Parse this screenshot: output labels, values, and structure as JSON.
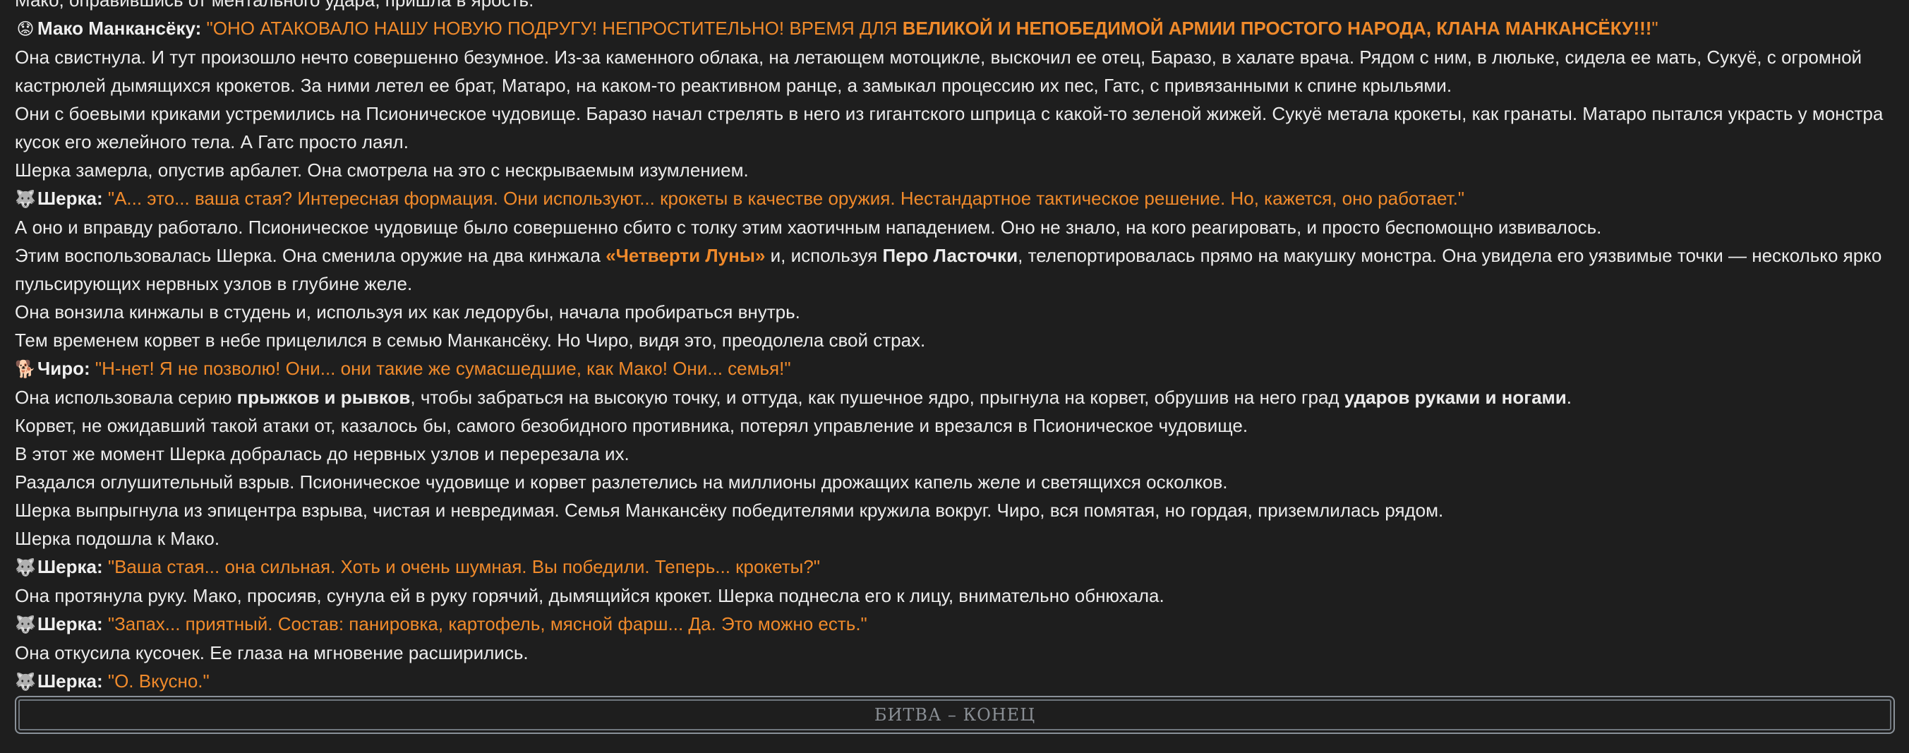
{
  "icons": {
    "mako": "😟",
    "sherka": "🐺",
    "chiro": "🐕"
  },
  "colors": {
    "background": "#1e1e1e",
    "text": "#ececec",
    "accent": "#f08a2b",
    "banner_border": "#8a9199"
  },
  "lines": {
    "l0": "Мако, оправившись от ментального удара, пришла в ярость.",
    "l1_speaker": "Мако Манкансёку:",
    "l1_quote_a": "\"ОНО АТАКОВАЛО НАШУ НОВУЮ ПОДРУГУ! НЕПРОСТИТЕЛЬНО! ВРЕМЯ ДЛЯ ",
    "l1_quote_b": "ВЕЛИКОЙ И НЕПОБЕДИМОЙ АРМИИ ПРОСТОГО НАРОДА, КЛАНА МАНКАНСЁКУ!!!",
    "l1_quote_c": "\"",
    "l2": "Она свистнула. И тут произошло нечто совершенно безумное. Из-за каменного облака, на летающем мотоцикле, выскочил ее отец, Баразо, в халате врача. Рядом с ним, в люльке, сидела ее мать, Сукуё, с огромной кастрюлей дымящихся крокетов. За ними летел ее брат, Матаро, на каком-то реактивном ранце, а замыкал процессию их пес, Гатс, с привязанными к спине крыльями.",
    "l3": "Они с боевыми криками устремились на Псионическое чудовище. Баразо начал стрелять в него из гигантского шприца с какой-то зеленой жижей. Сукуё метала крокеты, как гранаты. Матаро пытался украсть у монстра кусок его желейного тела. А Гатс просто лаял.",
    "l4": "Шерка замерла, опустив арбалет. Она смотрела на это с нескрываемым изумлением.",
    "l5_speaker": "Шерка:",
    "l5_quote": "\"А... это... ваша стая? Интересная формация. Они используют... крокеты в качестве оружия. Нестандартное тактическое решение. Но, кажется, оно работает.\"",
    "l6": "А оно и вправду работало. Псионическое чудовище было совершенно сбито с толку этим хаотичным нападением. Оно не знало, на кого реагировать, и просто беспомощно извивалось.",
    "l7_a": "Этим воспользовалась Шерка. Она сменила оружие на два кинжала ",
    "l7_b": "«Четверти Луны»",
    "l7_c": " и, используя ",
    "l7_d": "Перо Ласточки",
    "l7_e": ", телепортировалась прямо на макушку монстра. Она увидела его уязвимые точки — несколько ярко пульсирующих нервных узлов в глубине желе.",
    "l8": "Она вонзила кинжалы в студень и, используя их как ледорубы, начала пробираться внутрь.",
    "l9": "Тем временем корвет в небе прицелился в семью Манкансёку. Но Чиро, видя это, преодолела свой страх.",
    "l10_speaker": "Чиро:",
    "l10_quote": "\"Н-нет! Я не позволю! Они... они такие же сумасшедшие, как Мако! Они... семья!\"",
    "l11_a": "Она использовала серию ",
    "l11_b": "прыжков и рывков",
    "l11_c": ", чтобы забраться на высокую точку, и оттуда, как пушечное ядро, прыгнула на корвет, обрушив на него град ",
    "l11_d": "ударов руками и ногами",
    "l11_e": ".",
    "l12": "Корвет, не ожидавший такой атаки от, казалось бы, самого безобидного противника, потерял управление и врезался в Псионическое чудовище.",
    "l13": "В этот же момент Шерка добралась до нервных узлов и перерезала их.",
    "l14": "Раздался оглушительный взрыв. Псионическое чудовище и корвет разлетелись на миллионы дрожащих капель желе и светящихся осколков.",
    "l15": "Шерка выпрыгнула из эпицентра взрыва, чистая и невредимая. Семья Манкансёку победителями кружила вокруг. Чиро, вся помятая, но гордая, приземлилась рядом.",
    "l16": "Шерка подошла к Мако.",
    "l17_speaker": "Шерка:",
    "l17_quote": "\"Ваша стая... она сильная. Хоть и очень шумная. Вы победили. Теперь... крокеты?\"",
    "l18": "Она протянула руку. Мако, просияв, сунула ей в руку горячий, дымящийся крокет. Шерка поднесла его к лицу, внимательно обнюхала.",
    "l19_speaker": "Шерка:",
    "l19_quote": "\"Запах... приятный. Состав: панировка, картофель, мясной фарш... Да. Это можно есть.\"",
    "l20": "Она откусила кусочек. Ее глаза на мгновение расширились.",
    "l21_speaker": "Шерка:",
    "l21_quote": "\"О. Вкусно.\""
  },
  "banner": {
    "label": "БИТВА – КОНЕЦ"
  }
}
